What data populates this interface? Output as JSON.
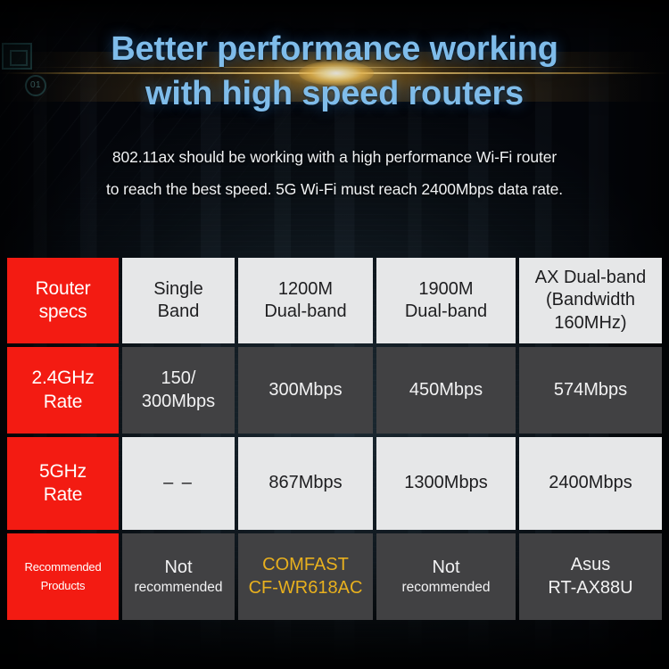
{
  "hero": {
    "headline_line1": "Better performance working",
    "headline_line2": "with high speed routers",
    "subcopy_line1": "802.11ax should be working with a high performance Wi-Fi router",
    "subcopy_line2": "to reach the best speed. 5G Wi-Fi must reach 2400Mbps data rate.",
    "headline_color": "#7fbcea",
    "subcopy_color": "#f0f2f4",
    "flare_color": "#ffcc55",
    "chip_badge_label": "01"
  },
  "table": {
    "accent_color": "#f31b12",
    "light_cell_color": "#e6e7e8",
    "dark_cell_color": "#414143",
    "highlight_color": "#e8b01e",
    "rows": [
      {
        "label_line1": "Router",
        "label_line2": "specs",
        "cells": [
          {
            "line1": "Single",
            "line2": "Band"
          },
          {
            "line1": "1200M",
            "line2": "Dual-band"
          },
          {
            "line1": "1900M",
            "line2": "Dual-band"
          },
          {
            "line1": "AX Dual-band",
            "line2": "(Bandwidth",
            "line3": "160MHz)"
          }
        ]
      },
      {
        "label_line1": "2.4GHz",
        "label_line2": "Rate",
        "cells": [
          {
            "line1": "150/",
            "line2": "300Mbps"
          },
          {
            "line1": "300Mbps"
          },
          {
            "line1": "450Mbps"
          },
          {
            "line1": "574Mbps"
          }
        ]
      },
      {
        "label_line1": "5GHz",
        "label_line2": "Rate",
        "cells": [
          {
            "line1": "– –"
          },
          {
            "line1": "867Mbps"
          },
          {
            "line1": "1300Mbps"
          },
          {
            "line1": "2400Mbps"
          }
        ]
      },
      {
        "label_line1": "Recommended",
        "label_line2": "Products",
        "cells": [
          {
            "line1": "Not",
            "line2": "recommended"
          },
          {
            "line1": "COMFAST",
            "line2": "CF-WR618AC"
          },
          {
            "line1": "Not",
            "line2": "recommended"
          },
          {
            "line1": "Asus",
            "line2": "RT-AX88U"
          }
        ]
      }
    ]
  }
}
